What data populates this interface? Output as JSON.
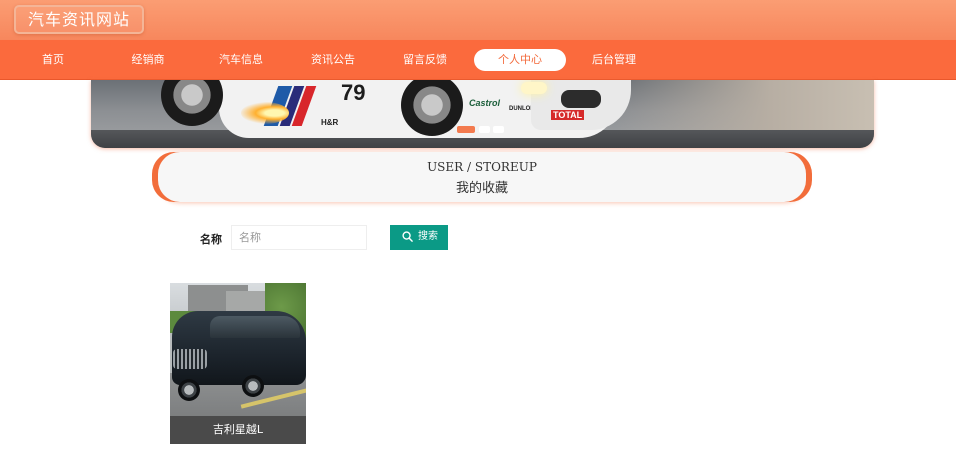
{
  "header": {
    "site_title": "汽车资讯网站"
  },
  "nav": {
    "items": [
      {
        "label": "首页"
      },
      {
        "label": "经销商"
      },
      {
        "label": "汽车信息"
      },
      {
        "label": "资讯公告"
      },
      {
        "label": "留言反馈"
      },
      {
        "label": "个人中心",
        "active": true
      },
      {
        "label": "后台管理"
      }
    ]
  },
  "banner": {
    "car_number": "79",
    "sponsors": [
      "Castrol",
      "DUNLOP",
      "TOTAL",
      "H&R"
    ],
    "indicator_count": 3,
    "active_indicator": 0
  },
  "breadcrumb": {
    "english": "USER / STOREUP",
    "chinese": "我的收藏"
  },
  "search": {
    "label": "名称",
    "placeholder": "名称",
    "value": "",
    "button_label": "搜索",
    "button_icon": "search-icon"
  },
  "favorites": [
    {
      "name": "吉利星越L"
    }
  ],
  "colors": {
    "header": "#f7875d",
    "nav": "#fb6a3d",
    "accent": "#f26d3b",
    "search_button": "#0b9a86",
    "card_caption": "#4a4a4a"
  }
}
